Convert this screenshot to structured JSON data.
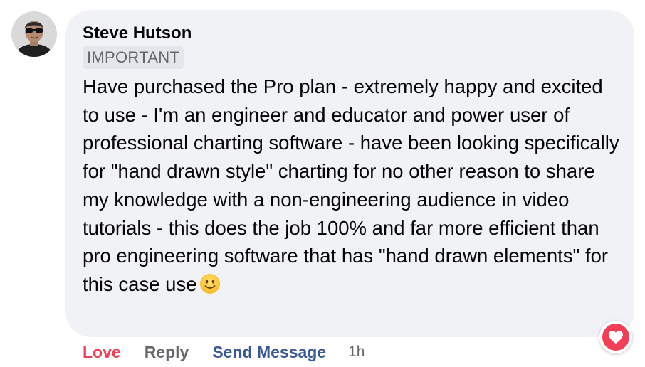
{
  "comment": {
    "author": "Steve Hutson",
    "badge": "IMPORTANT",
    "text": "Have purchased the Pro plan - extremely happy and excited to use - I'm an engineer and educator and power user of professional charting software - have been looking specifically for \"hand drawn style\" charting for no other reason to share my knowledge with a non-engineering audience in video tutorials - this does the job 100% and far more efficient than pro engineering software that has \"hand drawn elements\" for this case use",
    "emoji_icon": "slightly-smiling-face-icon",
    "reaction_icon": "heart-icon",
    "reaction_color": "#f33e58"
  },
  "actions": {
    "love_label": "Love",
    "reply_label": "Reply",
    "send_message_label": "Send Message",
    "timestamp": "1h"
  },
  "colors": {
    "bubble_background": "#f0f2f5",
    "badge_background": "#e4e6eb",
    "secondary_text": "#65676b",
    "link_blue": "#385898",
    "love_red": "#f33e58"
  }
}
